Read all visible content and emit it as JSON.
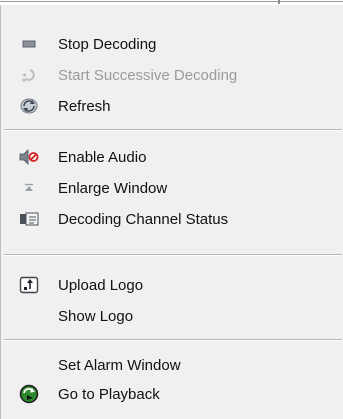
{
  "context_menu": {
    "items": [
      {
        "label": "Stop Decoding",
        "icon": "stop-decoding-icon",
        "enabled": true
      },
      {
        "label": "Start Successive Decoding",
        "icon": "successive-decoding-icon",
        "enabled": false
      },
      {
        "label": "Refresh",
        "icon": "refresh-icon",
        "enabled": true
      },
      {
        "label": "Enable Audio",
        "icon": "audio-disabled-icon",
        "enabled": true
      },
      {
        "label": "Enlarge Window",
        "icon": "enlarge-icon",
        "enabled": true
      },
      {
        "label": "Decoding Channel Status",
        "icon": "channel-status-icon",
        "enabled": true
      },
      {
        "label": "Upload Logo",
        "icon": "upload-icon",
        "enabled": true
      },
      {
        "label": "Show Logo",
        "icon": "",
        "enabled": true
      },
      {
        "label": "Set Alarm Window",
        "icon": "",
        "enabled": true
      },
      {
        "label": "Go to Playback",
        "icon": "playback-icon",
        "enabled": true
      }
    ]
  },
  "colors": {
    "menu_background": "#f0f0f0",
    "text": "#111111",
    "disabled_text": "#9b9b9b",
    "separator": "#b8b8b8"
  }
}
